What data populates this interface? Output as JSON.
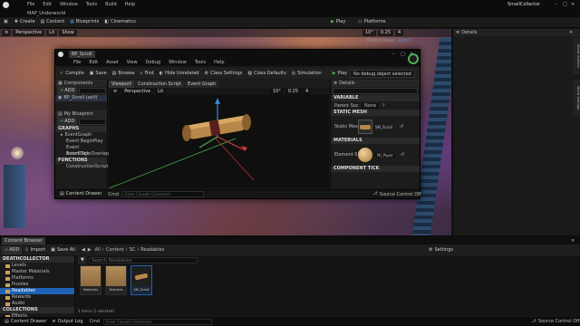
{
  "window": {
    "level_name": "MAP_Underworld",
    "project_name": "SmallCollector",
    "window_controls": [
      "–",
      "□",
      "✕"
    ]
  },
  "menu": {
    "items": [
      "File",
      "Edit",
      "Window",
      "Tools",
      "Build",
      "Help"
    ]
  },
  "toolbar": {
    "items": [
      {
        "label": "Create",
        "icon": "create-icon"
      },
      {
        "label": "Content",
        "icon": "content-icon"
      },
      {
        "label": "Blueprints",
        "icon": "blueprints-icon"
      },
      {
        "label": "Cinematics",
        "icon": "cinematics-icon"
      }
    ],
    "play_label": "Play",
    "platforms_label": "Platforms"
  },
  "level_viewport": {
    "mode": "Perspective",
    "view_mode": "Lit",
    "show": "Show",
    "snap_angle": "10°",
    "snap_scale": "0.25",
    "camera_speed": "4",
    "parent_class": "Parent class:",
    "parent_value": "Actor"
  },
  "main_details": {
    "title": "Details",
    "close": "✕"
  },
  "side_tabs": [
    "World Outliner",
    "World Settings"
  ],
  "bp_editor": {
    "title": "BP_Scroll",
    "menu": [
      "File",
      "Edit",
      "Asset",
      "View",
      "Debug",
      "Window",
      "Tools",
      "Help"
    ],
    "toolbar": {
      "compile": "Compile",
      "save": "Save",
      "browse": "Browse",
      "find": "Find",
      "hide_unrelated": "Hide Unrelated",
      "class_settings": "Class Settings",
      "class_defaults": "Class Defaults",
      "simulation": "Simulation",
      "play": "Play",
      "debug_filter": "No debug object selected"
    },
    "components": {
      "title": "Components",
      "add_label": "ADD",
      "search_placeholder": "Search",
      "root": "BP_Scroll (self)",
      "items": [
        "StaticMesh",
        "ItemCollision"
      ]
    },
    "my_blueprint": {
      "title": "My Blueprint",
      "add_label": "ADD",
      "graphs_header": "GRAPHS",
      "graph_name": "EventGraph",
      "events": [
        "Event BeginPlay",
        "Event ActorBeginOverlap",
        "Event Tick"
      ],
      "functions_header": "FUNCTIONS",
      "functions": [
        "ConstructionScript"
      ]
    },
    "center_tabs": [
      "Viewport",
      "Construction Script",
      "Event Graph"
    ],
    "viewport": {
      "mode": "Perspective",
      "view_mode": "Lit",
      "snap_angle": "10°",
      "snap_scale": "0.25",
      "camera_speed": "4"
    },
    "details": {
      "title": "Details",
      "search_placeholder": "Search",
      "variable_header": "VARIABLE",
      "parent_label": "Parent Soc",
      "parent_value": "None",
      "static_mesh_header": "STATIC MESH",
      "static_mesh_label": "Static Mesh",
      "static_mesh_value": "SM_Scroll",
      "materials_header": "MATERIALS",
      "element_label": "Element 0",
      "element_value": "MI_Paper",
      "element_dropdown": "MI_Paper",
      "next_header": "COMPONENT TICK"
    },
    "bottom": {
      "content_drawer": "Content Drawer",
      "cmd_label": "Cmd",
      "console_placeholder": "Enter Console Command",
      "source_control": "Source Control Off"
    }
  },
  "content_browser": {
    "tab_label": "Content Browser",
    "add_label": "ADD",
    "import_label": "Import",
    "save_all_label": "Save All",
    "breadcrumb": [
      "All",
      "Content",
      "SC",
      "Readables"
    ],
    "settings_label": "Settings",
    "search_placeholder": "Search Readables",
    "tree_header": "DEATHCOLLECTOR",
    "tree": [
      "Levels",
      "Master Materials",
      "Platforms",
      "Puzzles",
      "Readables",
      "Rewards",
      "Audio",
      "Blueprints",
      "Effects"
    ],
    "selected_tree_item": "Readables",
    "collections_header": "COLLECTIONS",
    "assets": [
      {
        "label": "Materials"
      },
      {
        "label": "Textures"
      },
      {
        "label": "SM_Scroll"
      }
    ],
    "item_count": "3 items (1 selected)"
  },
  "status": {
    "content_drawer": "Content Drawer",
    "output_log": "Output Log",
    "cmd_label": "Cmd",
    "console_placeholder": "Enter Console Command",
    "source_control": "Source Control Off"
  },
  "colors": {
    "accent_play": "#4caf50",
    "selection_blue": "#1e62b5",
    "axis_x": "#d63a3a",
    "axis_y": "#4caf50",
    "axis_z": "#3a86d6"
  }
}
